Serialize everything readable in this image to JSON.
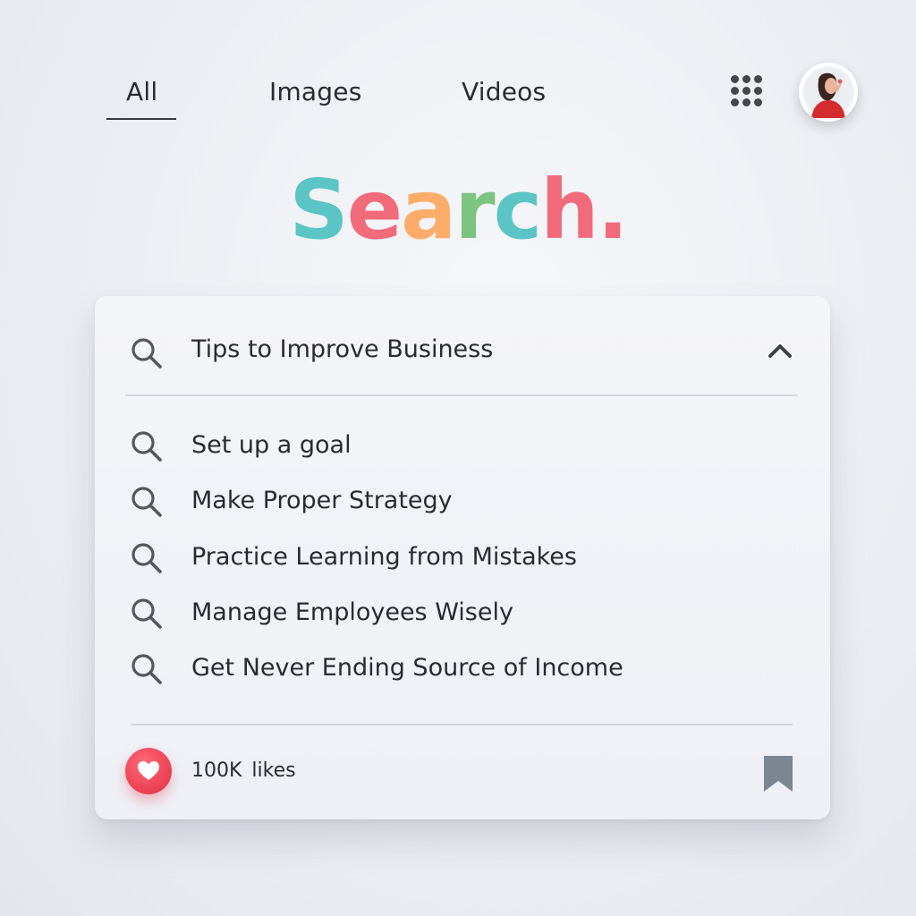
{
  "tabs": [
    {
      "label": "All",
      "active": true
    },
    {
      "label": "Images",
      "active": false
    },
    {
      "label": "Videos",
      "active": false
    }
  ],
  "header": {
    "apps_icon": "apps-grid-icon",
    "avatar_icon": "user-avatar"
  },
  "logo": {
    "letters": [
      {
        "char": "S",
        "color": "#5bc4c4"
      },
      {
        "char": "e",
        "color": "#f26b7b"
      },
      {
        "char": "a",
        "color": "#ffac6a"
      },
      {
        "char": "r",
        "color": "#7cc47f"
      },
      {
        "char": "c",
        "color": "#5bc4c4"
      },
      {
        "char": "h",
        "color": "#f26b7b"
      },
      {
        "char": ".",
        "color": "#f26b7b"
      }
    ]
  },
  "search": {
    "query": "Tips to Improve Business",
    "icon": "search-icon",
    "collapse_icon": "chevron-up-icon"
  },
  "suggestions": [
    {
      "label": "Set up a goal"
    },
    {
      "label": "Make Proper Strategy"
    },
    {
      "label": "Practice Learning from Mistakes"
    },
    {
      "label": "Manage Employees Wisely"
    },
    {
      "label": "Get Never Ending Source of Income"
    }
  ],
  "footer": {
    "likes_label": "100K likes",
    "heart_icon": "heart-icon",
    "bookmark_icon": "bookmark-icon",
    "heart_color": "#ee4457",
    "bookmark_color": "#7d8593"
  }
}
